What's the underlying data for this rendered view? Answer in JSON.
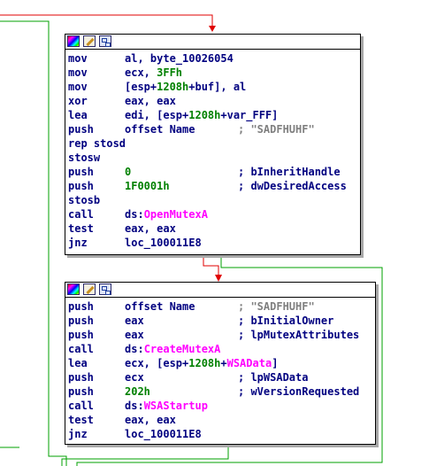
{
  "colors": {
    "mnemonic": "#000080",
    "number": "#008000",
    "import": "#ff00ff",
    "comment": "#808080",
    "edge_true": "#00a000",
    "edge_false": "#e00000",
    "shadow": "#a8a8a8"
  },
  "block1": {
    "title_icons": [
      "palette-icon",
      "rename-icon",
      "graph-overview-icon"
    ],
    "lines": [
      {
        "mn": "mov",
        "op_parts": [
          {
            "t": "al, byte_10026054"
          }
        ]
      },
      {
        "mn": "mov",
        "op_parts": [
          {
            "t": "ecx, "
          },
          {
            "t": "3FFh",
            "c": "num"
          }
        ]
      },
      {
        "mn": "mov",
        "op_parts": [
          {
            "t": "[esp+"
          },
          {
            "t": "1208h",
            "c": "num"
          },
          {
            "t": "+buf], al"
          }
        ]
      },
      {
        "mn": "xor",
        "op_parts": [
          {
            "t": "eax, eax"
          }
        ]
      },
      {
        "mn": "lea",
        "op_parts": [
          {
            "t": "edi, [esp+"
          },
          {
            "t": "1208h",
            "c": "num"
          },
          {
            "t": "+var_FFF]"
          }
        ]
      },
      {
        "mn": "push",
        "op_parts": [
          {
            "t": "offset Name"
          }
        ],
        "comment": "; \"SADFHUHF\"",
        "ccls": "cm"
      },
      {
        "mn": "rep stosd",
        "op_parts": []
      },
      {
        "mn": "stosw",
        "op_parts": []
      },
      {
        "mn": "push",
        "op_parts": [
          {
            "t": "0",
            "c": "num"
          }
        ],
        "comment": "; bInheritHandle",
        "ccls": "cmt"
      },
      {
        "mn": "push",
        "op_parts": [
          {
            "t": "1F0001h",
            "c": "num"
          }
        ],
        "comment": "; dwDesiredAccess",
        "ccls": "cmt"
      },
      {
        "mn": "stosb",
        "op_parts": []
      },
      {
        "mn": "call",
        "op_parts": [
          {
            "t": "ds:"
          },
          {
            "t": "OpenMutexA",
            "c": "fn"
          }
        ]
      },
      {
        "mn": "test",
        "op_parts": [
          {
            "t": "eax, eax"
          }
        ]
      },
      {
        "mn": "jnz",
        "op_parts": [
          {
            "t": "loc_100011E8"
          }
        ]
      }
    ]
  },
  "block2": {
    "title_icons": [
      "palette-icon",
      "rename-icon",
      "graph-overview-icon"
    ],
    "lines": [
      {
        "mn": "push",
        "op_parts": [
          {
            "t": "offset Name"
          }
        ],
        "comment": "; \"SADFHUHF\"",
        "ccls": "cm"
      },
      {
        "mn": "push",
        "op_parts": [
          {
            "t": "eax"
          }
        ],
        "comment": "; bInitialOwner",
        "ccls": "cmt"
      },
      {
        "mn": "push",
        "op_parts": [
          {
            "t": "eax"
          }
        ],
        "comment": "; lpMutexAttributes",
        "ccls": "cmt"
      },
      {
        "mn": "call",
        "op_parts": [
          {
            "t": "ds:"
          },
          {
            "t": "CreateMutexA",
            "c": "fn"
          }
        ]
      },
      {
        "mn": "lea",
        "op_parts": [
          {
            "t": "ecx, [esp+"
          },
          {
            "t": "1208h",
            "c": "num"
          },
          {
            "t": "+"
          },
          {
            "t": "WSAData",
            "c": "fn"
          },
          {
            "t": "]"
          }
        ]
      },
      {
        "mn": "push",
        "op_parts": [
          {
            "t": "ecx"
          }
        ],
        "comment": "; lpWSAData",
        "ccls": "cmt"
      },
      {
        "mn": "push",
        "op_parts": [
          {
            "t": "202h",
            "c": "num"
          }
        ],
        "comment": "; wVersionRequested",
        "ccls": "cmt"
      },
      {
        "mn": "call",
        "op_parts": [
          {
            "t": "ds:"
          },
          {
            "t": "WSAStartup",
            "c": "fn"
          }
        ]
      },
      {
        "mn": "test",
        "op_parts": [
          {
            "t": "eax, eax"
          }
        ]
      },
      {
        "mn": "jnz",
        "op_parts": [
          {
            "t": "loc_100011E8"
          }
        ]
      }
    ]
  }
}
